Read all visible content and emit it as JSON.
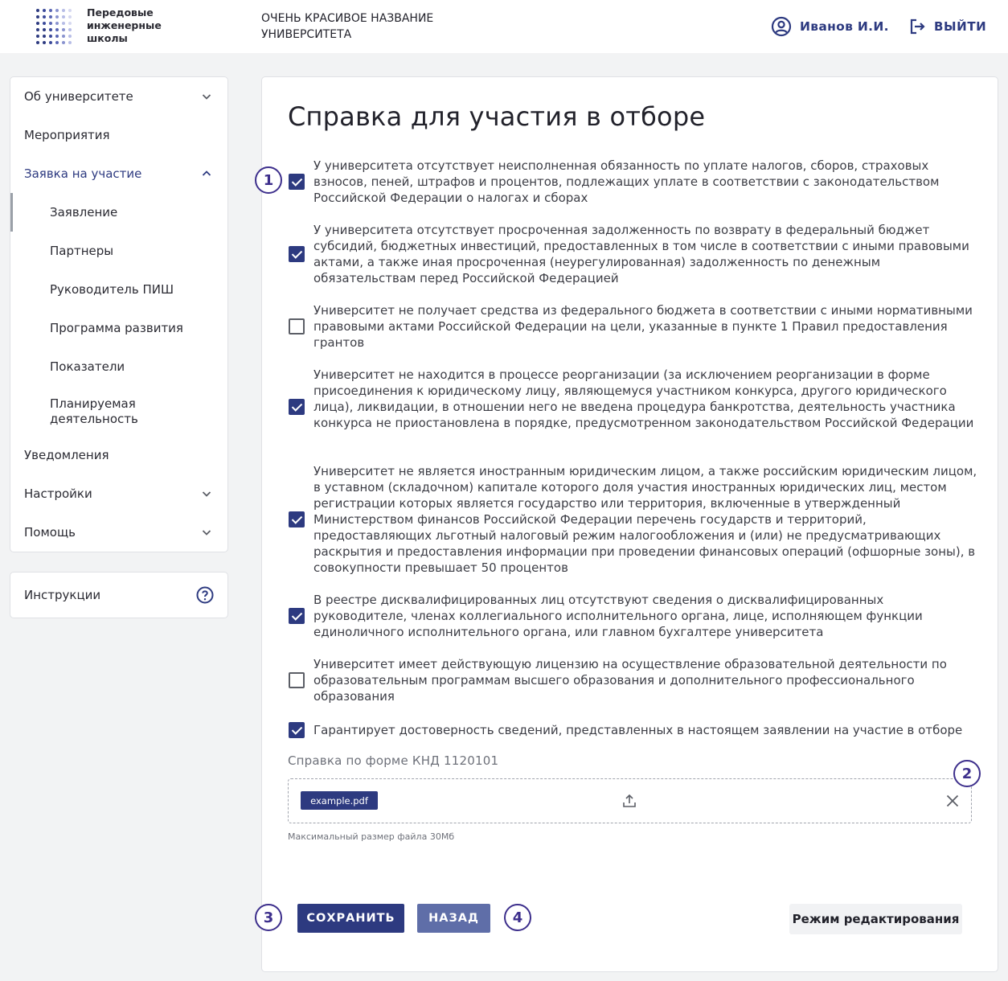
{
  "header": {
    "logo_lines": [
      "Передовые",
      "инженерные",
      "школы"
    ],
    "university_title_lines": [
      "ОЧЕНЬ КРАСИВОЕ НАЗВАНИЕ",
      "УНИВЕРСИТЕТА"
    ],
    "user_name": "Иванов И.И.",
    "logout_label": "ВЫЙТИ"
  },
  "sidebar": {
    "items": [
      {
        "label": "Об университете",
        "icon": "chevron-down-icon"
      },
      {
        "label": "Мероприятия"
      },
      {
        "label": "Заявка на участие",
        "icon": "chevron-up-icon",
        "expanded": true
      },
      {
        "label": "Заявление",
        "sub": true,
        "active": true
      },
      {
        "label": "Партнеры",
        "sub": true
      },
      {
        "label": "Руководитель ПИШ",
        "sub": true
      },
      {
        "label": "Программа развития",
        "sub": true
      },
      {
        "label": "Показатели",
        "sub": true
      },
      {
        "label": "Планируемая деятельность",
        "sub": true
      },
      {
        "label": "Уведомления"
      },
      {
        "label": "Настройки",
        "icon": "chevron-down-icon"
      },
      {
        "label": "Помощь",
        "icon": "chevron-down-icon"
      }
    ],
    "instructions_label": "Инструкции"
  },
  "main": {
    "title": "Справка для участия в отборе",
    "checkboxes": [
      {
        "checked": true,
        "text": "У университета отсутствует неисполненная обязанность по уплате налогов, сборов, страховых взносов, пеней, штрафов и процентов, подлежащих уплате в соответствии с законодательством Российской Федерации о налогах и сборах"
      },
      {
        "checked": true,
        "text": "У университета отсутствует просроченная задолженность по возврату в федеральный бюджет субсидий, бюджетных инвестиций, предоставленных в том числе в соответствии с иными правовыми актами, а также иная просроченная (неурегулированная) задолженность по денежным обязательствам перед Российской Федерацией"
      },
      {
        "checked": false,
        "text": "Университет не получает средства из федерального бюджета в соответствии с иными нормативными правовыми актами Российской Федерации на цели, указанные в пункте 1 Правил предоставления грантов"
      },
      {
        "checked": true,
        "text": "Университет не находится в процессе реорганизации (за исключением реорганизации в форме присоединения к юридическому лицу, являющемуся участником конкурса, другого юридического лица), ликвидации, в отношении него не введена процедура банкротства, деятельность участника конкурса не приостановлена в порядке, предусмотренном законодательством Российской Федерации"
      },
      {
        "checked": true,
        "text": "Университет не является иностранным юридическим лицом, а также российским юридическим лицом, в уставном (складочном) капитале которого доля участия иностранных юридических лиц, местом регистрации которых является государство или территория, включенные в утвержденный Министерством финансов Российской Федерации перечень государств и территорий, предоставляющих льготный налоговый режим налогообложения и (или) не предусматривающих раскрытия и предоставления информации при проведении финансовых операций (офшорные зоны), в совокупности превышает 50 процентов"
      },
      {
        "checked": true,
        "text": "В реестре дисквалифицированных лиц отсутствуют сведения о дисквалифицированных руководителе, членах коллегиального исполнительного органа, лице, исполняющем функции единоличного исполнительного органа, или главном бухгалтере университета"
      },
      {
        "checked": false,
        "text": "Университет имеет действующую лицензию на осуществление образовательной деятельности по образовательным программам высшего образования и дополнительного профессионального образования"
      },
      {
        "checked": true,
        "text": "Гарантирует достоверность сведений, представленных в настоящем заявлении на участие в отборе"
      }
    ],
    "file_label": "Справка по форме КНД 1120101",
    "file_name": "example.pdf",
    "file_hint": "Максимальный размер файла 30Мб",
    "save_label": "СОХРАНИТЬ",
    "back_label": "НАЗАД",
    "edit_mode_label": "Режим редактирования",
    "markers": [
      "1",
      "2",
      "3",
      "4"
    ]
  },
  "colors": {
    "primary": "#2d3a80",
    "secondary_button": "#5f6ea8",
    "marker": "#3d2f8c",
    "background": "#f2f3f4"
  }
}
